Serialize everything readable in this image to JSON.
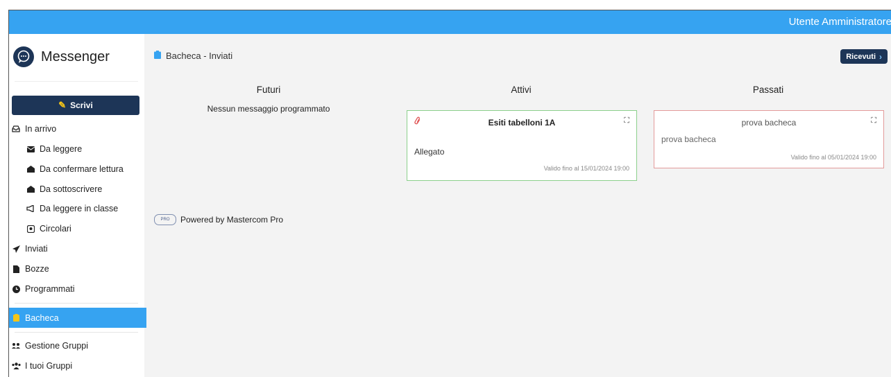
{
  "header": {
    "user": "Utente Amministratore"
  },
  "brand": {
    "name": "Messenger"
  },
  "sidebar": {
    "write_label": "Scrivi",
    "inbox": "In arrivo",
    "inbox_items": [
      "Da leggere",
      "Da confermare lettura",
      "Da sottoscrivere",
      "Da leggere in classe",
      "Circolari"
    ],
    "sent": "Inviati",
    "drafts": "Bozze",
    "scheduled": "Programmati",
    "board": "Bacheca",
    "groups_manage": "Gestione Gruppi",
    "your_groups": "I tuoi Gruppi"
  },
  "main": {
    "title": "Bacheca - Inviati",
    "received_button": "Ricevuti",
    "columns": {
      "future": "Futuri",
      "active": "Attivi",
      "past": "Passati"
    },
    "future_empty": "Nessun messaggio programmato",
    "active_card": {
      "title": "Esiti tabelloni 1A",
      "body": "Allegato",
      "valid": "Valido fino al 15/01/2024 19:00"
    },
    "past_card": {
      "title": "prova bacheca",
      "body": "prova bacheca",
      "valid": "Valido fino al 05/01/2024 19:00"
    },
    "powered_by": "Powered by Mastercom Pro"
  },
  "colors": {
    "accent": "#36a3f1",
    "navy": "#1d3557",
    "active_border": "#8bd08b",
    "past_border": "#e39a9a"
  }
}
